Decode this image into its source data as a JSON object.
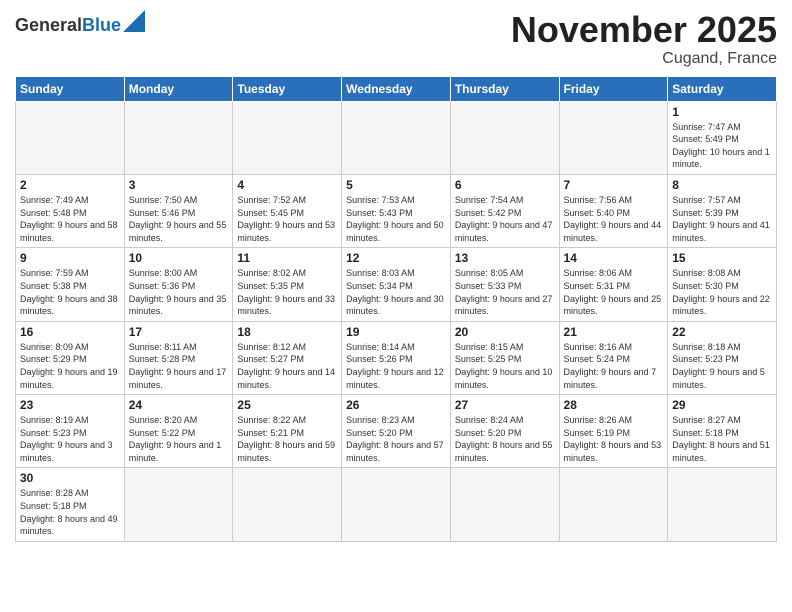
{
  "header": {
    "logo_general": "General",
    "logo_blue": "Blue",
    "month_title": "November 2025",
    "location": "Cugand, France"
  },
  "weekdays": [
    "Sunday",
    "Monday",
    "Tuesday",
    "Wednesday",
    "Thursday",
    "Friday",
    "Saturday"
  ],
  "weeks": [
    [
      {
        "day": "",
        "info": ""
      },
      {
        "day": "",
        "info": ""
      },
      {
        "day": "",
        "info": ""
      },
      {
        "day": "",
        "info": ""
      },
      {
        "day": "",
        "info": ""
      },
      {
        "day": "",
        "info": ""
      },
      {
        "day": "1",
        "info": "Sunrise: 7:47 AM\nSunset: 5:49 PM\nDaylight: 10 hours and 1 minute."
      }
    ],
    [
      {
        "day": "2",
        "info": "Sunrise: 7:49 AM\nSunset: 5:48 PM\nDaylight: 9 hours and 58 minutes."
      },
      {
        "day": "3",
        "info": "Sunrise: 7:50 AM\nSunset: 5:46 PM\nDaylight: 9 hours and 55 minutes."
      },
      {
        "day": "4",
        "info": "Sunrise: 7:52 AM\nSunset: 5:45 PM\nDaylight: 9 hours and 53 minutes."
      },
      {
        "day": "5",
        "info": "Sunrise: 7:53 AM\nSunset: 5:43 PM\nDaylight: 9 hours and 50 minutes."
      },
      {
        "day": "6",
        "info": "Sunrise: 7:54 AM\nSunset: 5:42 PM\nDaylight: 9 hours and 47 minutes."
      },
      {
        "day": "7",
        "info": "Sunrise: 7:56 AM\nSunset: 5:40 PM\nDaylight: 9 hours and 44 minutes."
      },
      {
        "day": "8",
        "info": "Sunrise: 7:57 AM\nSunset: 5:39 PM\nDaylight: 9 hours and 41 minutes."
      }
    ],
    [
      {
        "day": "9",
        "info": "Sunrise: 7:59 AM\nSunset: 5:38 PM\nDaylight: 9 hours and 38 minutes."
      },
      {
        "day": "10",
        "info": "Sunrise: 8:00 AM\nSunset: 5:36 PM\nDaylight: 9 hours and 35 minutes."
      },
      {
        "day": "11",
        "info": "Sunrise: 8:02 AM\nSunset: 5:35 PM\nDaylight: 9 hours and 33 minutes."
      },
      {
        "day": "12",
        "info": "Sunrise: 8:03 AM\nSunset: 5:34 PM\nDaylight: 9 hours and 30 minutes."
      },
      {
        "day": "13",
        "info": "Sunrise: 8:05 AM\nSunset: 5:33 PM\nDaylight: 9 hours and 27 minutes."
      },
      {
        "day": "14",
        "info": "Sunrise: 8:06 AM\nSunset: 5:31 PM\nDaylight: 9 hours and 25 minutes."
      },
      {
        "day": "15",
        "info": "Sunrise: 8:08 AM\nSunset: 5:30 PM\nDaylight: 9 hours and 22 minutes."
      }
    ],
    [
      {
        "day": "16",
        "info": "Sunrise: 8:09 AM\nSunset: 5:29 PM\nDaylight: 9 hours and 19 minutes."
      },
      {
        "day": "17",
        "info": "Sunrise: 8:11 AM\nSunset: 5:28 PM\nDaylight: 9 hours and 17 minutes."
      },
      {
        "day": "18",
        "info": "Sunrise: 8:12 AM\nSunset: 5:27 PM\nDaylight: 9 hours and 14 minutes."
      },
      {
        "day": "19",
        "info": "Sunrise: 8:14 AM\nSunset: 5:26 PM\nDaylight: 9 hours and 12 minutes."
      },
      {
        "day": "20",
        "info": "Sunrise: 8:15 AM\nSunset: 5:25 PM\nDaylight: 9 hours and 10 minutes."
      },
      {
        "day": "21",
        "info": "Sunrise: 8:16 AM\nSunset: 5:24 PM\nDaylight: 9 hours and 7 minutes."
      },
      {
        "day": "22",
        "info": "Sunrise: 8:18 AM\nSunset: 5:23 PM\nDaylight: 9 hours and 5 minutes."
      }
    ],
    [
      {
        "day": "23",
        "info": "Sunrise: 8:19 AM\nSunset: 5:23 PM\nDaylight: 9 hours and 3 minutes."
      },
      {
        "day": "24",
        "info": "Sunrise: 8:20 AM\nSunset: 5:22 PM\nDaylight: 9 hours and 1 minute."
      },
      {
        "day": "25",
        "info": "Sunrise: 8:22 AM\nSunset: 5:21 PM\nDaylight: 8 hours and 59 minutes."
      },
      {
        "day": "26",
        "info": "Sunrise: 8:23 AM\nSunset: 5:20 PM\nDaylight: 8 hours and 57 minutes."
      },
      {
        "day": "27",
        "info": "Sunrise: 8:24 AM\nSunset: 5:20 PM\nDaylight: 8 hours and 55 minutes."
      },
      {
        "day": "28",
        "info": "Sunrise: 8:26 AM\nSunset: 5:19 PM\nDaylight: 8 hours and 53 minutes."
      },
      {
        "day": "29",
        "info": "Sunrise: 8:27 AM\nSunset: 5:18 PM\nDaylight: 8 hours and 51 minutes."
      }
    ],
    [
      {
        "day": "30",
        "info": "Sunrise: 8:28 AM\nSunset: 5:18 PM\nDaylight: 8 hours and 49 minutes."
      },
      {
        "day": "",
        "info": ""
      },
      {
        "day": "",
        "info": ""
      },
      {
        "day": "",
        "info": ""
      },
      {
        "day": "",
        "info": ""
      },
      {
        "day": "",
        "info": ""
      },
      {
        "day": "",
        "info": ""
      }
    ]
  ]
}
